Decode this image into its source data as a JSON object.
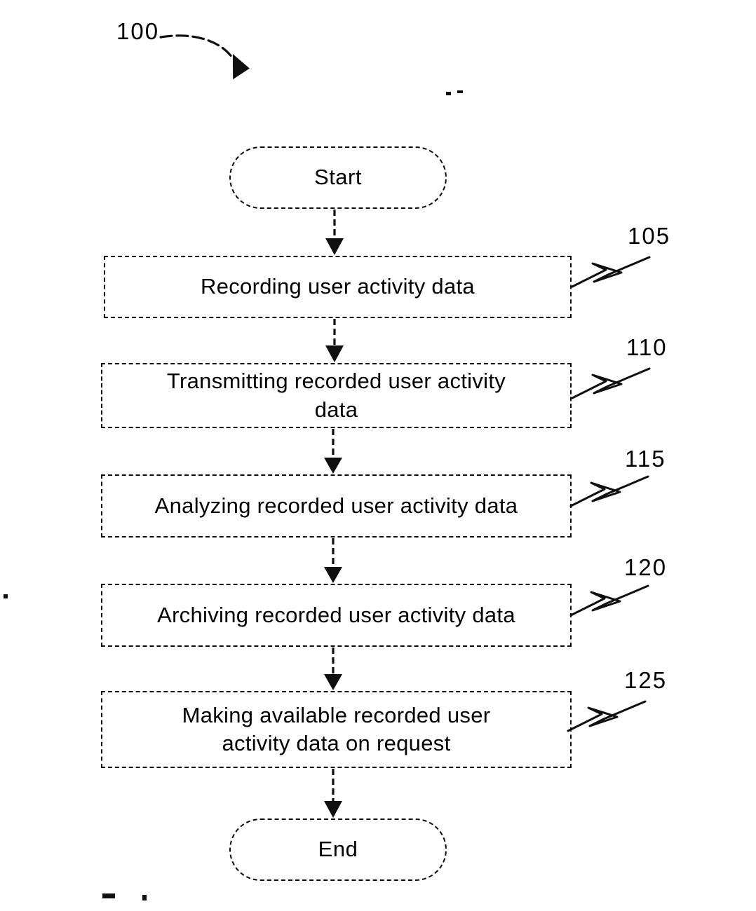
{
  "figure": {
    "figure_ref": "100",
    "type": "patent-flowchart",
    "nodes": [
      {
        "id": "start",
        "shape": "terminator",
        "label": "Start",
        "ref": null
      },
      {
        "id": "step-105",
        "shape": "process",
        "label": "Recording user activity data",
        "ref": "105"
      },
      {
        "id": "step-110",
        "shape": "process",
        "label": "Transmitting recorded user activity\ndata",
        "ref": "110"
      },
      {
        "id": "step-115",
        "shape": "process",
        "label": "Analyzing recorded user activity data",
        "ref": "115"
      },
      {
        "id": "step-120",
        "shape": "process",
        "label": "Archiving recorded user activity data",
        "ref": "120"
      },
      {
        "id": "step-125",
        "shape": "process",
        "label": "Making available recorded user\nactivity data on request",
        "ref": "125"
      },
      {
        "id": "end",
        "shape": "terminator",
        "label": "End",
        "ref": null
      }
    ],
    "callouts": [
      {
        "ref": "105"
      },
      {
        "ref": "110"
      },
      {
        "ref": "115"
      },
      {
        "ref": "120"
      },
      {
        "ref": "125"
      }
    ],
    "colors": {
      "ink": "#0a0a0a",
      "background": "#ffffff"
    }
  }
}
